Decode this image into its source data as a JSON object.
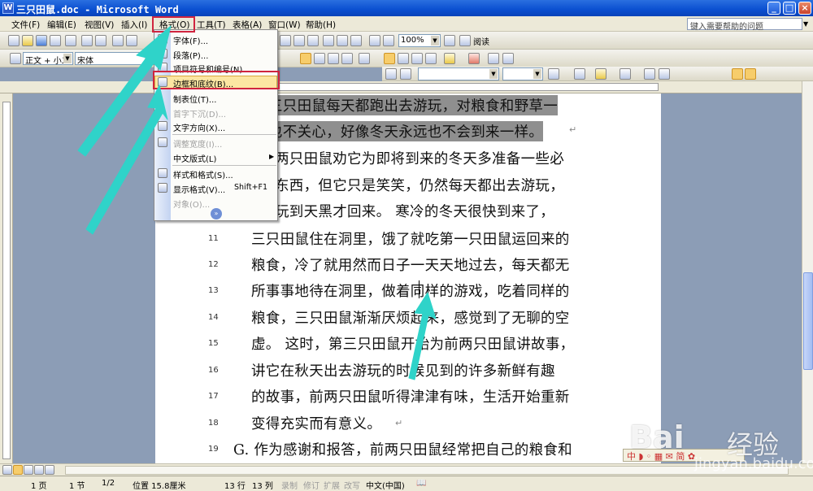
{
  "window": {
    "title": "三只田鼠.doc - Microsoft Word",
    "app_icon": "W",
    "minimize": "_",
    "maximize": "□",
    "close": "×"
  },
  "menubar": {
    "items": [
      "文件(F)",
      "编辑(E)",
      "视图(V)",
      "插入(I)",
      "格式(O)",
      "工具(T)",
      "表格(A)",
      "窗口(W)",
      "帮助(H)"
    ],
    "help_placeholder": "键入需要帮助的问题"
  },
  "toolbar": {
    "zoom": "100%",
    "reading": "阅读",
    "style": "正文 + 小二",
    "font": "宋体"
  },
  "format_menu": {
    "items": [
      {
        "label": "字体(F)...",
        "disabled": false
      },
      {
        "label": "段落(P)...",
        "disabled": false
      },
      {
        "label": "项目符号和编号(N)...",
        "disabled": false
      },
      {
        "label": "边框和底纹(B)...",
        "disabled": false,
        "highlighted": true
      },
      {
        "label": "制表位(T)...",
        "disabled": false
      },
      {
        "label": "首字下沉(D)...",
        "disabled": true
      },
      {
        "label": "文字方向(X)...",
        "disabled": false
      },
      {
        "label": "调整宽度(I)...",
        "disabled": true
      },
      {
        "label": "中文版式(L)",
        "disabled": false,
        "submenu": true
      },
      {
        "label": "样式和格式(S)...",
        "disabled": false
      },
      {
        "label": "显示格式(V)...",
        "disabled": false,
        "shortcut": "Shift+F1"
      },
      {
        "label": "对象(O)...",
        "disabled": true
      }
    ]
  },
  "document": {
    "lines": [
      {
        "num": "",
        "text": "三只田鼠每天都跑出去游玩，对粮食和野草一",
        "highlight": true
      },
      {
        "num": "",
        "text": "也不关心，好像冬天永远也不会到来一样。",
        "highlight": true
      },
      {
        "num": "",
        "text": "两只田鼠劝它为即将到来的冬天多准备一些必",
        "highlight": false
      },
      {
        "num": "",
        "text": "东西，但它只是笑笑，仍然每天都出去游玩，",
        "highlight": false
      },
      {
        "num": "",
        "text": "玩到天黑才回来。 寒冷的冬天很快到来了，",
        "highlight": false
      },
      {
        "num": "11",
        "text": "三只田鼠住在洞里，饿了就吃第一只田鼠运回来的",
        "highlight": false
      },
      {
        "num": "12",
        "text": "粮食，冷了就用然而日子一天天地过去，每天都无",
        "highlight": false
      },
      {
        "num": "13",
        "text": "所事事地待在洞里，做着同样的游戏，吃着同样的",
        "highlight": false
      },
      {
        "num": "14",
        "text": "粮食，三只田鼠渐渐厌烦起来，感觉到了无聊的空",
        "highlight": false
      },
      {
        "num": "15",
        "text": "虚。 这时，第三只田鼠开始为前两只田鼠讲故事，",
        "highlight": false
      },
      {
        "num": "16",
        "text": "讲它在秋天出去游玩的时候见到的许多新鲜有趣",
        "highlight": false
      },
      {
        "num": "17",
        "text": "的故事，前两只田鼠听得津津有味，生活开始重新",
        "highlight": false
      },
      {
        "num": "18",
        "text": "变得充实而有意义。",
        "highlight": false
      },
      {
        "num": "19",
        "text": "G. 作为感谢和报答，前两只田鼠经常把自己的粮食和",
        "highlight": false
      }
    ]
  },
  "statusbar": {
    "page": "1 页",
    "section": "1 节",
    "pages": "1/2",
    "position": "位置 15.8厘米",
    "row": "13 行",
    "col": "13 列",
    "rec": "录制",
    "trk": "修订",
    "ext": "扩展",
    "ovr": "改写",
    "lang": "中文(中国)"
  },
  "watermark": {
    "brand": "Bai",
    "brand2": "经验",
    "url": "jingyan.baidu.com"
  },
  "colors": {
    "titlebar": "#0a4fd0",
    "highlight_box": "#d0243f",
    "arrow": "#2fd3c9"
  }
}
